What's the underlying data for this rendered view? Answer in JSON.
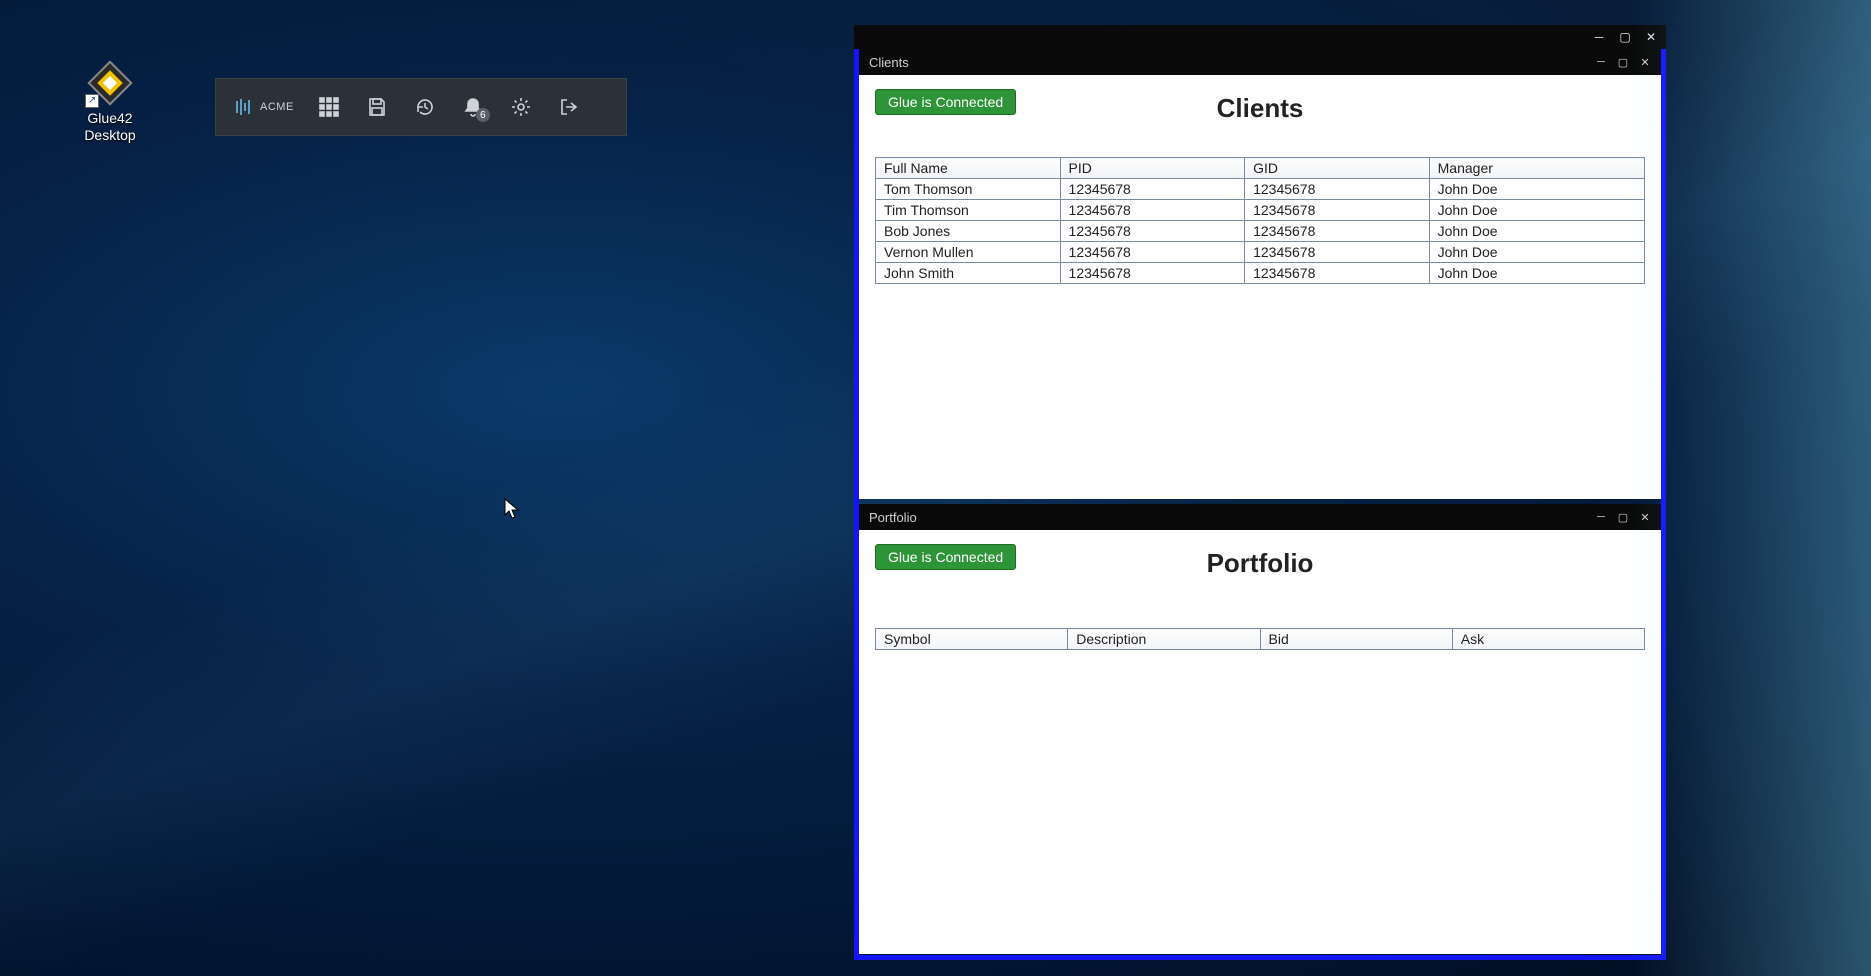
{
  "desktop": {
    "icon_label": "Glue42\nDesktop"
  },
  "toolbar": {
    "brand_text": "ACME",
    "notification_count": "6"
  },
  "group": {},
  "clients_window": {
    "title": "Clients",
    "status": "Glue is Connected",
    "heading": "Clients",
    "columns": [
      "Full Name",
      "PID",
      "GID",
      "Manager"
    ],
    "rows": [
      {
        "name": "Tom Thomson",
        "pid": "12345678",
        "gid": "12345678",
        "mgr": "John Doe"
      },
      {
        "name": "Tim Thomson",
        "pid": "12345678",
        "gid": "12345678",
        "mgr": "John Doe"
      },
      {
        "name": "Bob Jones",
        "pid": "12345678",
        "gid": "12345678",
        "mgr": "John Doe"
      },
      {
        "name": "Vernon Mullen",
        "pid": "12345678",
        "gid": "12345678",
        "mgr": "John Doe"
      },
      {
        "name": "John Smith",
        "pid": "12345678",
        "gid": "12345678",
        "mgr": "John Doe"
      }
    ]
  },
  "portfolio_window": {
    "title": "Portfolio",
    "status": "Glue is Connected",
    "heading": "Portfolio",
    "columns": [
      "Symbol",
      "Description",
      "Bid",
      "Ask"
    ],
    "rows": []
  }
}
